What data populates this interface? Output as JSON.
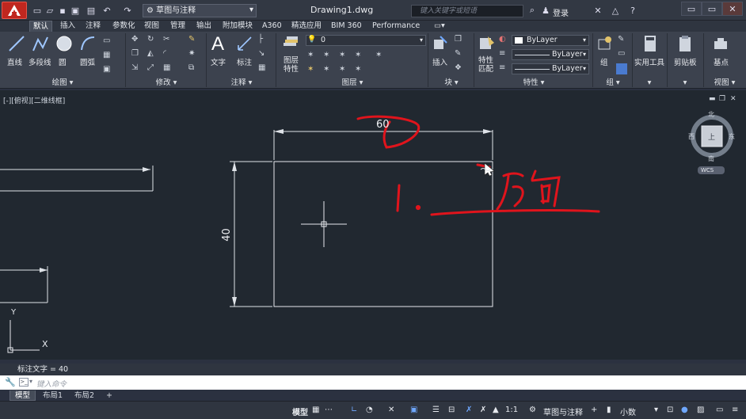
{
  "title_bar": {
    "workspace": "草图与注释",
    "doc_title": "Drawing1.dwg",
    "search_placeholder": "键入关键字或短语",
    "login": "登录"
  },
  "tabs": [
    "默认",
    "插入",
    "注释",
    "参数化",
    "视图",
    "管理",
    "输出",
    "附加模块",
    "A360",
    "精选应用",
    "BIM 360",
    "Performance"
  ],
  "ribbon": {
    "draw": {
      "line": "直线",
      "polyline": "多段线",
      "circle": "圆",
      "arc": "圆弧",
      "panel": "绘图"
    },
    "modify": {
      "panel": "修改"
    },
    "annotation": {
      "text": "文字",
      "dimension": "标注",
      "panel": "注释"
    },
    "layers": {
      "properties_1": "图层",
      "properties_2": "特性",
      "current_layer": "0",
      "panel": "图层"
    },
    "block": {
      "insert": "插入",
      "panel": "块"
    },
    "properties": {
      "match_1": "特性",
      "match_2": "匹配",
      "color": "ByLayer",
      "linetype": "ByLayer",
      "lineweight": "ByLayer",
      "panel": "特性"
    },
    "groups": {
      "group": "组",
      "panel": "组"
    },
    "utilities": {
      "label": "实用工具"
    },
    "clipboard": {
      "label": "剪贴板"
    },
    "base": {
      "label": "基点",
      "view_panel": "视图"
    }
  },
  "viewport": {
    "label": "[-][俯视][二维线框]",
    "dim_width": "60",
    "dim_height": "40"
  },
  "viewcube": {
    "north": "北",
    "south": "南",
    "east": "东",
    "west": "西",
    "top": "上",
    "wcs": "WCS"
  },
  "ucs": {
    "x": "X",
    "y": "Y"
  },
  "command": {
    "history": "标注文字 = 40",
    "placeholder": "键入命令"
  },
  "layout_tabs": [
    "模型",
    "布局1",
    "布局2"
  ],
  "statusbar": {
    "model": "模型",
    "scale": "1:1",
    "workspace": "草图与注释",
    "units": "小数"
  },
  "annotation": {
    "handwritten": "1. 方向"
  },
  "colors": {
    "accent_red": "#e0141c",
    "canvas": "#212830",
    "ribbon": "#3c424e"
  }
}
